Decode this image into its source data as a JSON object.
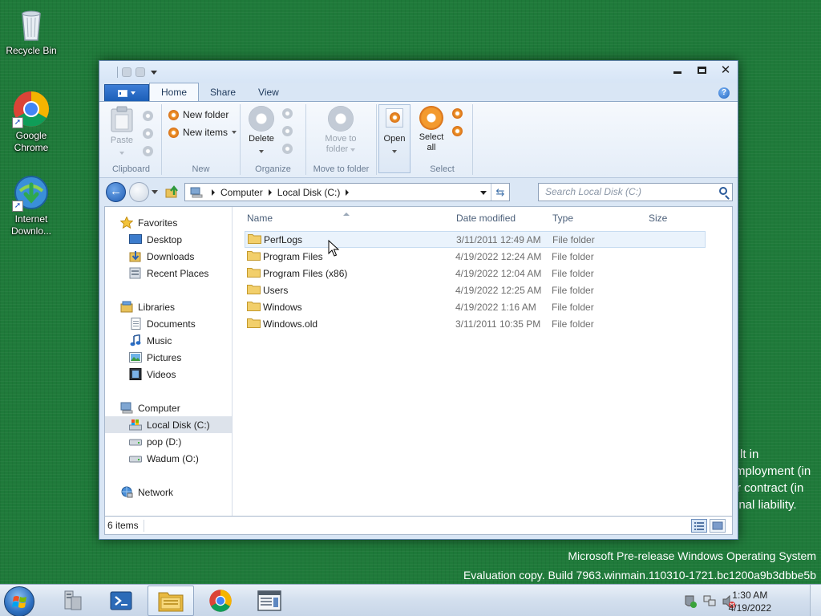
{
  "desktop": {
    "icons": [
      {
        "label": "Recycle Bin"
      },
      {
        "label_line1": "Google",
        "label_line2": "Chrome"
      },
      {
        "label_line1": "Internet",
        "label_line2": "Downlo..."
      }
    ],
    "background_text": [
      "lt in",
      "mployment (in",
      "r contract (in",
      "inal liability."
    ],
    "watermark_line1": "Microsoft Pre-release Windows Operating System",
    "watermark_line2": "Evaluation copy. Build 7963.winmain.110310-1721.bc1200a9b3dbbe5b"
  },
  "window": {
    "ribbon_tabs": [
      "Home",
      "Share",
      "View"
    ],
    "active_tab": "Home",
    "groups": {
      "clipboard": {
        "label": "Clipboard",
        "paste": "Paste"
      },
      "new": {
        "label": "New",
        "new_folder": "New folder",
        "new_items": "New items"
      },
      "organize": {
        "label": "Organize",
        "delete": "Delete"
      },
      "move": {
        "label": "Move to folder",
        "move_line1": "Move to",
        "move_line2": "folder"
      },
      "open": {
        "open": "Open"
      },
      "select": {
        "label": "Select",
        "select_line1": "Select",
        "select_line2": "all"
      }
    },
    "address": {
      "crumbs": [
        "Computer",
        "Local Disk (C:)"
      ]
    },
    "search": {
      "placeholder": "Search Local Disk (C:)"
    },
    "nav": {
      "favorites": {
        "label": "Favorites",
        "items": [
          "Desktop",
          "Downloads",
          "Recent Places"
        ]
      },
      "libraries": {
        "label": "Libraries",
        "items": [
          "Documents",
          "Music",
          "Pictures",
          "Videos"
        ]
      },
      "computer": {
        "label": "Computer",
        "items": [
          "Local Disk (C:)",
          "pop (D:)",
          "Wadum (O:)"
        ],
        "selected": "Local Disk (C:)"
      },
      "network": {
        "label": "Network"
      }
    },
    "columns": {
      "name": "Name",
      "date": "Date modified",
      "type": "Type",
      "size": "Size"
    },
    "files": [
      {
        "name": "PerfLogs",
        "date": "3/11/2011 12:49 AM",
        "type": "File folder"
      },
      {
        "name": "Program Files",
        "date": "4/19/2022 12:24 AM",
        "type": "File folder"
      },
      {
        "name": "Program Files (x86)",
        "date": "4/19/2022 12:04 AM",
        "type": "File folder"
      },
      {
        "name": "Users",
        "date": "4/19/2022 12:25 AM",
        "type": "File folder"
      },
      {
        "name": "Windows",
        "date": "4/19/2022 1:16 AM",
        "type": "File folder"
      },
      {
        "name": "Windows.old",
        "date": "3/11/2011 10:35 PM",
        "type": "File folder"
      }
    ],
    "status": {
      "count": "6 items"
    }
  },
  "taskbar": {
    "clock_time": "1:30 AM",
    "clock_date": "4/19/2022"
  },
  "colors": {
    "desktop_bg": "#1f7a3a",
    "accent": "#1b5fb8",
    "orange": "#f0962a"
  }
}
